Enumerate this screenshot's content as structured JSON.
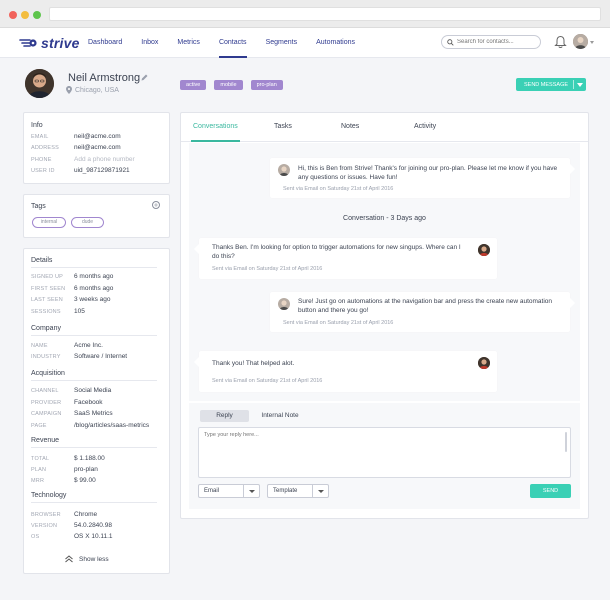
{
  "nav": {
    "brand": "strive",
    "links": [
      "Dashboard",
      "Inbox",
      "Metrics",
      "Contacts",
      "Segments",
      "Automations"
    ],
    "active_index": 3,
    "search_placeholder": "Search for contacts..."
  },
  "profile": {
    "name": "Neil Armstrong",
    "location": "Chicago, USA",
    "badges": [
      "active",
      "mobile",
      "pro-plan"
    ],
    "send_button": "SEND MESSAGE"
  },
  "info": {
    "title": "Info",
    "rows": [
      {
        "key": "EMAIL",
        "value": "neil@acme.com"
      },
      {
        "key": "ADDRESS",
        "value": "neil@acme.com"
      },
      {
        "key": "PHONE",
        "value": "Add a phone number"
      },
      {
        "key": "USER ID",
        "value": "uid_987129871921"
      }
    ]
  },
  "tags": {
    "title": "Tags",
    "items": [
      "internal",
      "dude"
    ]
  },
  "details": {
    "title": "Details",
    "rows": [
      {
        "key": "SIGNED UP",
        "value": "6 months ago"
      },
      {
        "key": "FIRST SEEN",
        "value": "6 months ago"
      },
      {
        "key": "LAST SEEN",
        "value": "3 weeks ago"
      },
      {
        "key": "SESSIONS",
        "value": "105"
      }
    ],
    "company_title": "Company",
    "company": [
      {
        "key": "NAME",
        "value": "Acme Inc."
      },
      {
        "key": "INDUSTRY",
        "value": "Software / Internet"
      }
    ],
    "acquisition_title": "Acquisition",
    "acquisition": [
      {
        "key": "CHANNEL",
        "value": "Social Media"
      },
      {
        "key": "PROVIDER",
        "value": "Facebook"
      },
      {
        "key": "CAMPAIGN",
        "value": "SaaS Metrics"
      },
      {
        "key": "PAGE",
        "value": "/blog/articles/saas-metrics"
      }
    ],
    "revenue_title": "Revenue",
    "revenue": [
      {
        "key": "TOTAL",
        "value": "$ 1.188.00"
      },
      {
        "key": "PLAN",
        "value": "pro-plan"
      },
      {
        "key": "MRR",
        "value": "$ 99.00"
      }
    ],
    "technology_title": "Technology",
    "technology": [
      {
        "key": "BROWSER",
        "value": "Chrome"
      },
      {
        "key": "VERSION",
        "value": "54.0.2840.98"
      },
      {
        "key": "OS",
        "value": "OS X 10.11.1"
      }
    ],
    "show_less": "Show less"
  },
  "tabs": [
    "Conversations",
    "Tasks",
    "Notes",
    "Activity"
  ],
  "conversation": {
    "messages": [
      {
        "text": "Hi, this is Ben from Strive! Thank's for joining our pro-plan. Please let me know if you have any questions or issues. Have fun!",
        "meta": "Sent via Email on Saturday 21st of April 2016"
      },
      {
        "text": "Thanks Ben. I'm looking for option to trigger automations for new singups. Where can I do this?",
        "meta": "Sent via Email on Saturday 21st of April 2016"
      },
      {
        "text": "Sure! Just go on automations at the navigation bar and press the create new automation button and there you go!",
        "meta": "Sent via Email on Saturday 21st of April 2016"
      },
      {
        "text": "Thank you! That helped alot.",
        "meta": "Sent via Email on Saturday 21st of April 2016"
      }
    ],
    "divider": "Conversation - 3 Days ago"
  },
  "reply": {
    "tab_reply": "Reply",
    "tab_note": "Internal Note",
    "placeholder": "Type your reply here...",
    "channel": "Email",
    "template": "Template",
    "send": "SEND"
  }
}
